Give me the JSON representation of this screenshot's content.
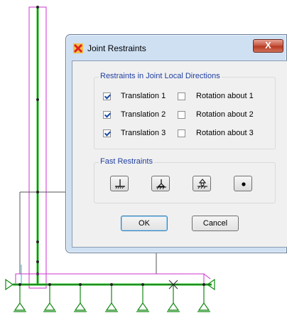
{
  "dialog": {
    "title": "Joint Restraints",
    "close_label": "X",
    "local_group": {
      "title": "Restraints in Joint Local Directions",
      "rows": [
        {
          "translation_label": "Translation  1",
          "translation_checked": true,
          "rotation_label": "Rotation about  1",
          "rotation_checked": false
        },
        {
          "translation_label": "Translation  2",
          "translation_checked": true,
          "rotation_label": "Rotation about  2",
          "rotation_checked": false
        },
        {
          "translation_label": "Translation  3",
          "translation_checked": true,
          "rotation_label": "Rotation about  3",
          "rotation_checked": false
        }
      ]
    },
    "fast_group": {
      "title": "Fast Restraints",
      "buttons": [
        "fixed-support-icon",
        "pinned-support-icon",
        "roller-support-icon",
        "free-joint-icon"
      ]
    },
    "ok_label": "OK",
    "cancel_label": "Cancel"
  },
  "colors": {
    "frame_green": "#22cc22",
    "frame_magenta": "#cc33cc",
    "support_green": "#118811",
    "dialog_frame": "#cfe0f3",
    "group_title": "#1f3fa0"
  }
}
